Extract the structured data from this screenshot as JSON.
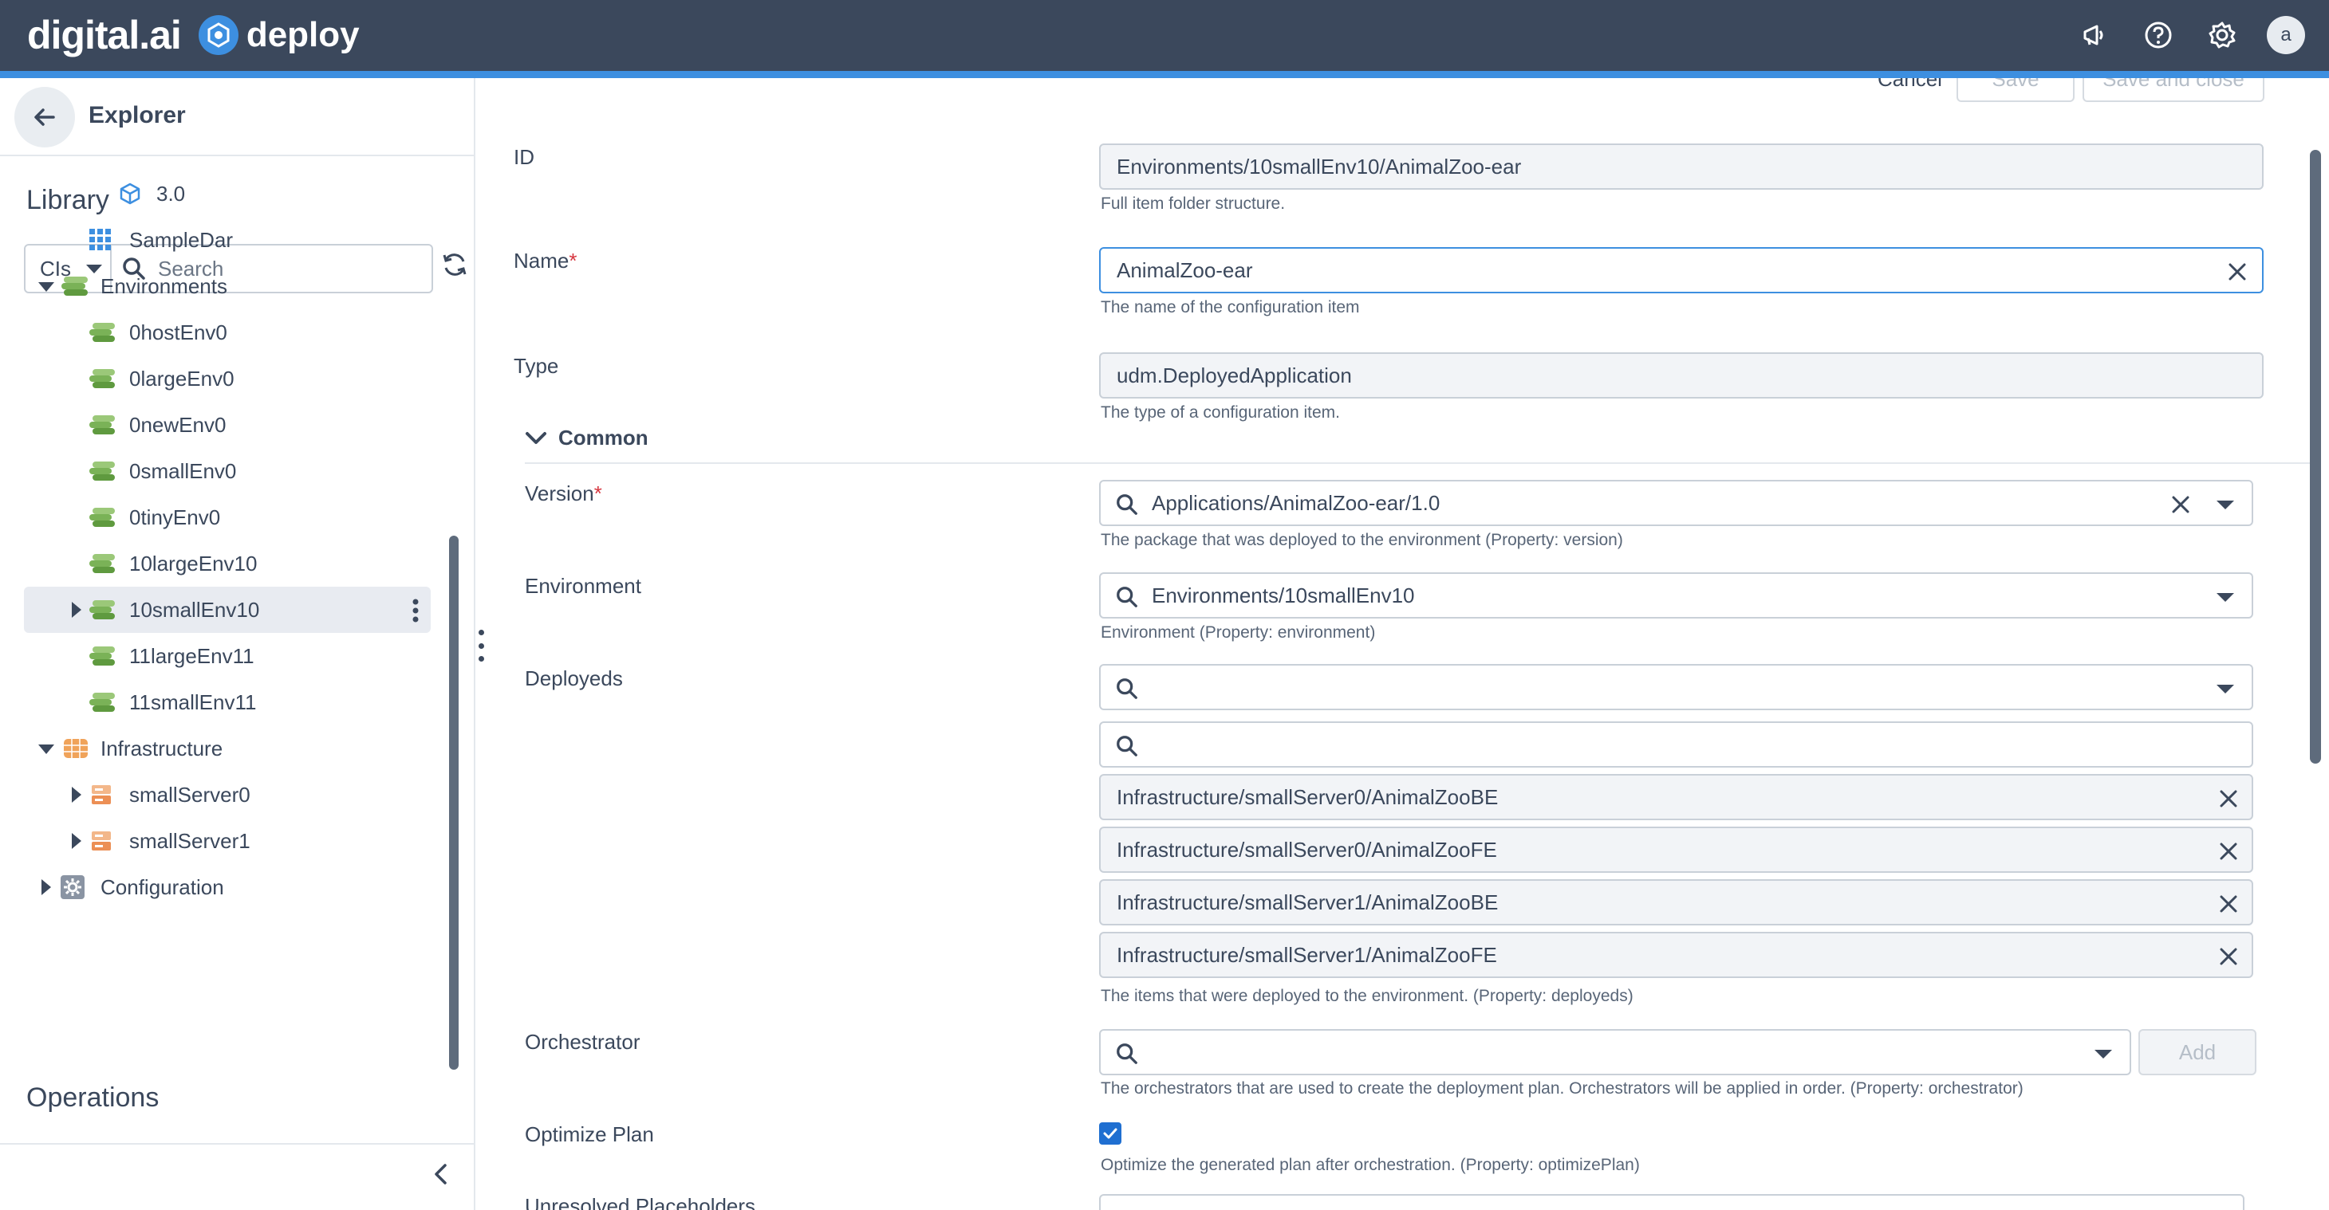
{
  "topbar": {
    "brand": "digital.ai",
    "product": "deploy",
    "icons": [
      "megaphone-icon",
      "help-icon",
      "gear-icon"
    ],
    "avatar_initial": "a",
    "accent_color": "#3d8fe0",
    "bg_color": "#3b485c"
  },
  "sidebar": {
    "title": "Explorer",
    "library_title": "Library",
    "filter_select": "CIs",
    "search_placeholder": "Search",
    "tree": [
      {
        "label": "3.0",
        "icon": "package-icon",
        "level": 3
      },
      {
        "label": "SampleDar",
        "icon": "grid-icon",
        "level": 2
      },
      {
        "label": "Environments",
        "icon": "environments-icon",
        "level": 1,
        "expanded": true
      },
      {
        "label": "0hostEnv0",
        "icon": "environment-icon",
        "level": 2
      },
      {
        "label": "0largeEnv0",
        "icon": "environment-icon",
        "level": 2
      },
      {
        "label": "0newEnv0",
        "icon": "environment-icon",
        "level": 2
      },
      {
        "label": "0smallEnv0",
        "icon": "environment-icon",
        "level": 2
      },
      {
        "label": "0tinyEnv0",
        "icon": "environment-icon",
        "level": 2
      },
      {
        "label": "10largeEnv10",
        "icon": "environment-icon",
        "level": 2
      },
      {
        "label": "10smallEnv10",
        "icon": "environment-icon",
        "level": 2,
        "selected": true
      },
      {
        "label": "11largeEnv11",
        "icon": "environment-icon",
        "level": 2
      },
      {
        "label": "11smallEnv11",
        "icon": "environment-icon",
        "level": 2
      },
      {
        "label": "Infrastructure",
        "icon": "infrastructure-icon",
        "level": 1,
        "expanded": true
      },
      {
        "label": "smallServer0",
        "icon": "server-icon",
        "level": 2
      },
      {
        "label": "smallServer1",
        "icon": "server-icon",
        "level": 2
      },
      {
        "label": "Configuration",
        "icon": "configuration-icon",
        "level": 1
      }
    ],
    "operations_title": "Operations"
  },
  "actions": {
    "cancel": "Cancel",
    "save": "Save",
    "save_close": "Save and close"
  },
  "form": {
    "id": {
      "label": "ID",
      "value": "Environments/10smallEnv10/AnimalZoo-ear",
      "help": "Full item folder structure."
    },
    "name": {
      "label": "Name",
      "required": "*",
      "value": "AnimalZoo-ear",
      "help": "The name of the configuration item"
    },
    "type": {
      "label": "Type",
      "value": "udm.DeployedApplication",
      "help": "The type of a configuration item."
    },
    "section": "Common",
    "version": {
      "label": "Version",
      "required": "*",
      "value": "Applications/AnimalZoo-ear/1.0",
      "help": "The package that was deployed to the environment (Property: version)"
    },
    "environment": {
      "label": "Environment",
      "value": "Environments/10smallEnv10",
      "help": "Environment (Property: environment)"
    },
    "deployeds": {
      "label": "Deployeds",
      "items": [
        "Infrastructure/smallServer0/AnimalZooBE",
        "Infrastructure/smallServer0/AnimalZooFE",
        "Infrastructure/smallServer1/AnimalZooBE",
        "Infrastructure/smallServer1/AnimalZooFE"
      ],
      "help": "The items that were deployed to the environment. (Property: deployeds)"
    },
    "orchestrator": {
      "label": "Orchestrator",
      "add_label": "Add",
      "help": "The orchestrators that are used to create the deployment plan. Orchestrators will be applied in order. (Property: orchestrator)"
    },
    "optimize_plan": {
      "label": "Optimize Plan",
      "checked": true,
      "help": "Optimize the generated plan after orchestration. (Property: optimizePlan)"
    },
    "unresolved_placeholders": {
      "label": "Unresolved Placeholders"
    }
  }
}
